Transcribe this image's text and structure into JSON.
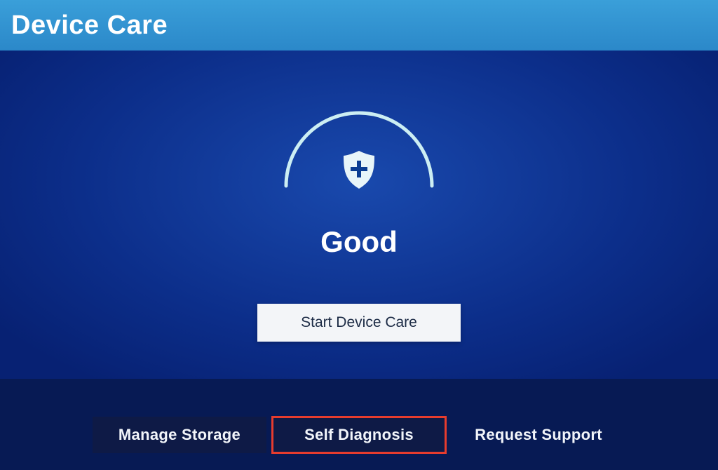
{
  "header": {
    "title": "Device Care"
  },
  "status": {
    "label": "Good",
    "colors": {
      "arc": "#cceef3",
      "shield_fill": "#e8f5f9",
      "plus": "#0b3d92"
    }
  },
  "actions": {
    "primary_label": "Start Device Care"
  },
  "footer": {
    "tabs": [
      {
        "label": "Manage Storage"
      },
      {
        "label": "Self Diagnosis"
      },
      {
        "label": "Request Support"
      }
    ]
  }
}
